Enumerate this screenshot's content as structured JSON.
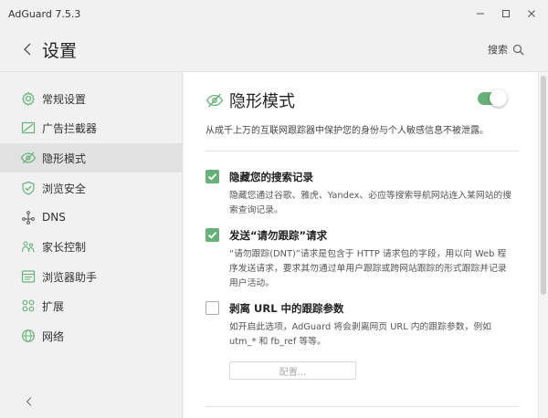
{
  "window": {
    "title": "AdGuard 7.5.3"
  },
  "header": {
    "page_title": "设置",
    "search_label": "搜索"
  },
  "sidebar": {
    "items": [
      {
        "label": "常规设置",
        "icon": "gear-icon"
      },
      {
        "label": "广告拦截器",
        "icon": "ad-blocker-icon"
      },
      {
        "label": "隐形模式",
        "icon": "eye-slash-icon"
      },
      {
        "label": "浏览安全",
        "icon": "shield-check-icon"
      },
      {
        "label": "DNS",
        "icon": "dns-icon"
      },
      {
        "label": "家长控制",
        "icon": "family-icon"
      },
      {
        "label": "浏览器助手",
        "icon": "browser-icon"
      },
      {
        "label": "扩展",
        "icon": "extensions-icon"
      },
      {
        "label": "网络",
        "icon": "globe-icon"
      }
    ],
    "active_index": 2
  },
  "main": {
    "section_title": "隐形模式",
    "section_enabled": true,
    "section_desc": "从成千上万的互联网跟踪器中保护您的身份与个人敏感信息不被泄露。",
    "options": [
      {
        "title": "隐藏您的搜索记录",
        "desc": "隐藏您通过谷歌、雅虎、Yandex、必应等搜索导航网站连入某网站的搜索查询记录。",
        "checked": true
      },
      {
        "title": "发送“请勿跟踪”请求",
        "desc": "“请勿跟踪(DNT)”请求是包含于 HTTP 请求包的字段，用以向 Web 程序发送请求，要求其勿通过单用户跟踪或跨网站跟踪的形式跟踪并记录用户活动。",
        "checked": true
      },
      {
        "title": "剥离 URL 中的跟踪参数",
        "desc": "如开启此选项，AdGuard 将会剥离网页 URL 内的跟踪参数，例如 utm_* 和 fb_ref 等等。",
        "checked": false
      }
    ],
    "config_button": "配置..."
  },
  "colors": {
    "accent": "#67b279",
    "background": "#f1f1f1",
    "content_bg": "#ffffff",
    "active_nav": "#e2e2e2"
  }
}
